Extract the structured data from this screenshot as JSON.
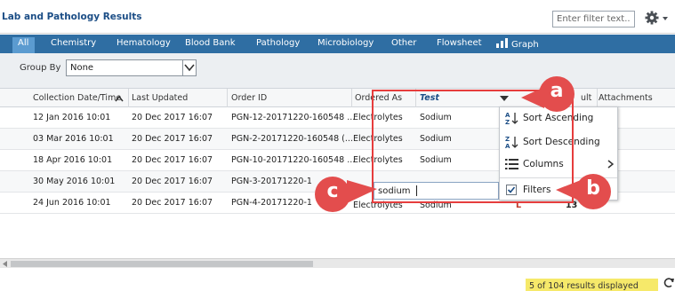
{
  "title": "Lab and Pathology Results",
  "filter": {
    "placeholder": "Enter filter text..."
  },
  "tabs": [
    {
      "label": "All",
      "active": true
    },
    {
      "label": "Chemistry"
    },
    {
      "label": "Hematology"
    },
    {
      "label": "Blood Bank"
    },
    {
      "label": "Pathology"
    },
    {
      "label": "Microbiology"
    },
    {
      "label": "Other"
    },
    {
      "label": "Flowsheet"
    },
    {
      "label": "Graph"
    }
  ],
  "group_by": {
    "label": "Group By",
    "value": "None"
  },
  "columns": [
    {
      "label": "Collection Date/Time"
    },
    {
      "label": "Last Updated"
    },
    {
      "label": "Order ID"
    },
    {
      "label": "Ordered As"
    },
    {
      "label": "Test"
    },
    {
      "label": "ult"
    },
    {
      "label": "Attachments"
    }
  ],
  "rows": [
    {
      "collection": "12 Jan 2016 10:01",
      "updated": "20 Dec 2017 16:07",
      "order_id": "PGN-12-20171220-160548 ...",
      "ordered_as": "Electrolytes",
      "test": "Sodium"
    },
    {
      "collection": "03 Mar 2016 10:01",
      "updated": "20 Dec 2017 16:07",
      "order_id": "PGN-2-20171220-160548 (...",
      "ordered_as": "Electrolytes",
      "test": "Sodium"
    },
    {
      "collection": "18 Apr 2016 10:01",
      "updated": "20 Dec 2017 16:07",
      "order_id": "PGN-10-20171220-160548 ...",
      "ordered_as": "Electrolytes",
      "test": "Sodium"
    },
    {
      "collection": "30 May 2016 10:01",
      "updated": "20 Dec 2017 16:07",
      "order_id": "PGN-3-20171220-1",
      "ordered_as": "",
      "test": ""
    },
    {
      "collection": "24 Jun 2016 10:01",
      "updated": "20 Dec 2017 16:07",
      "order_id": "PGN-4-20171220-1",
      "ordered_as": "Electrolytes",
      "test": "Sodium",
      "extra_flag": "L",
      "extra_value": "13"
    }
  ],
  "menu": {
    "items": [
      {
        "label": "Sort Ascending"
      },
      {
        "label": "Sort Descending"
      },
      {
        "label": "Columns"
      },
      {
        "label": "Filters",
        "checked": true
      }
    ]
  },
  "filter_value": "sodium",
  "status": {
    "message": "5 of 104 results displayed"
  },
  "callouts": {
    "a": "a",
    "b": "b",
    "c": "c"
  },
  "colors": {
    "accent": "#2f6ea3",
    "callout": "#e34d4d",
    "status_bg": "#f6e96a"
  }
}
